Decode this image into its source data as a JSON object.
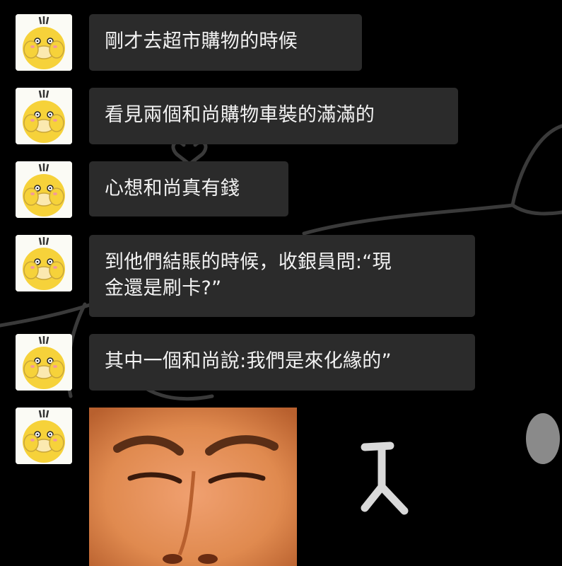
{
  "chat": {
    "messages": [
      {
        "text": "剛才去超市購物的時候"
      },
      {
        "text": "看見兩個和尚購物車裝的滿滿的"
      },
      {
        "text": "心想和尚真有錢"
      },
      {
        "text": "到他們結賬的時候，收銀員問:“現\n金還是刷卡?”"
      },
      {
        "text": "其中一個和尚說:我們是來化緣的”"
      }
    ],
    "avatar_icon": "psyduck-avatar-icon",
    "image_message": "face-reaction-photo",
    "colors": {
      "background": "#000000",
      "bubble": "#2b2b2b",
      "text": "#f2f2f2",
      "avatar_yellow": "#f6d23a"
    }
  }
}
